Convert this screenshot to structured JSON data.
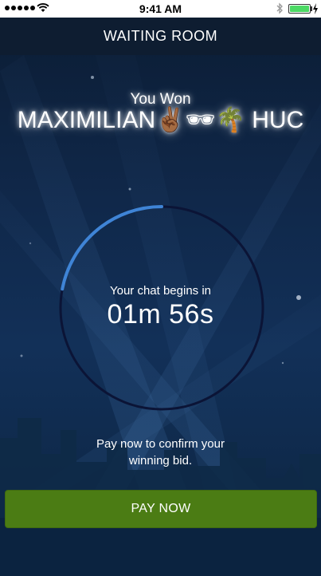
{
  "status_bar": {
    "time": "9:41 AM",
    "battery_level": 1.0
  },
  "header": {
    "title": "WAITING ROOM"
  },
  "winner": {
    "label": "You Won",
    "name": "MAXIMILIAN✌🏾🕶🌴 HUC"
  },
  "countdown": {
    "label": "Your chat begins in",
    "value": "01m 56s",
    "progress": 0.22,
    "progress_color": "#3f84d6",
    "track_color": "#0b1436"
  },
  "payment": {
    "message": "Pay now to confirm your winning bid.",
    "button_label": "PAY NOW",
    "button_color": "#4b7c14"
  }
}
